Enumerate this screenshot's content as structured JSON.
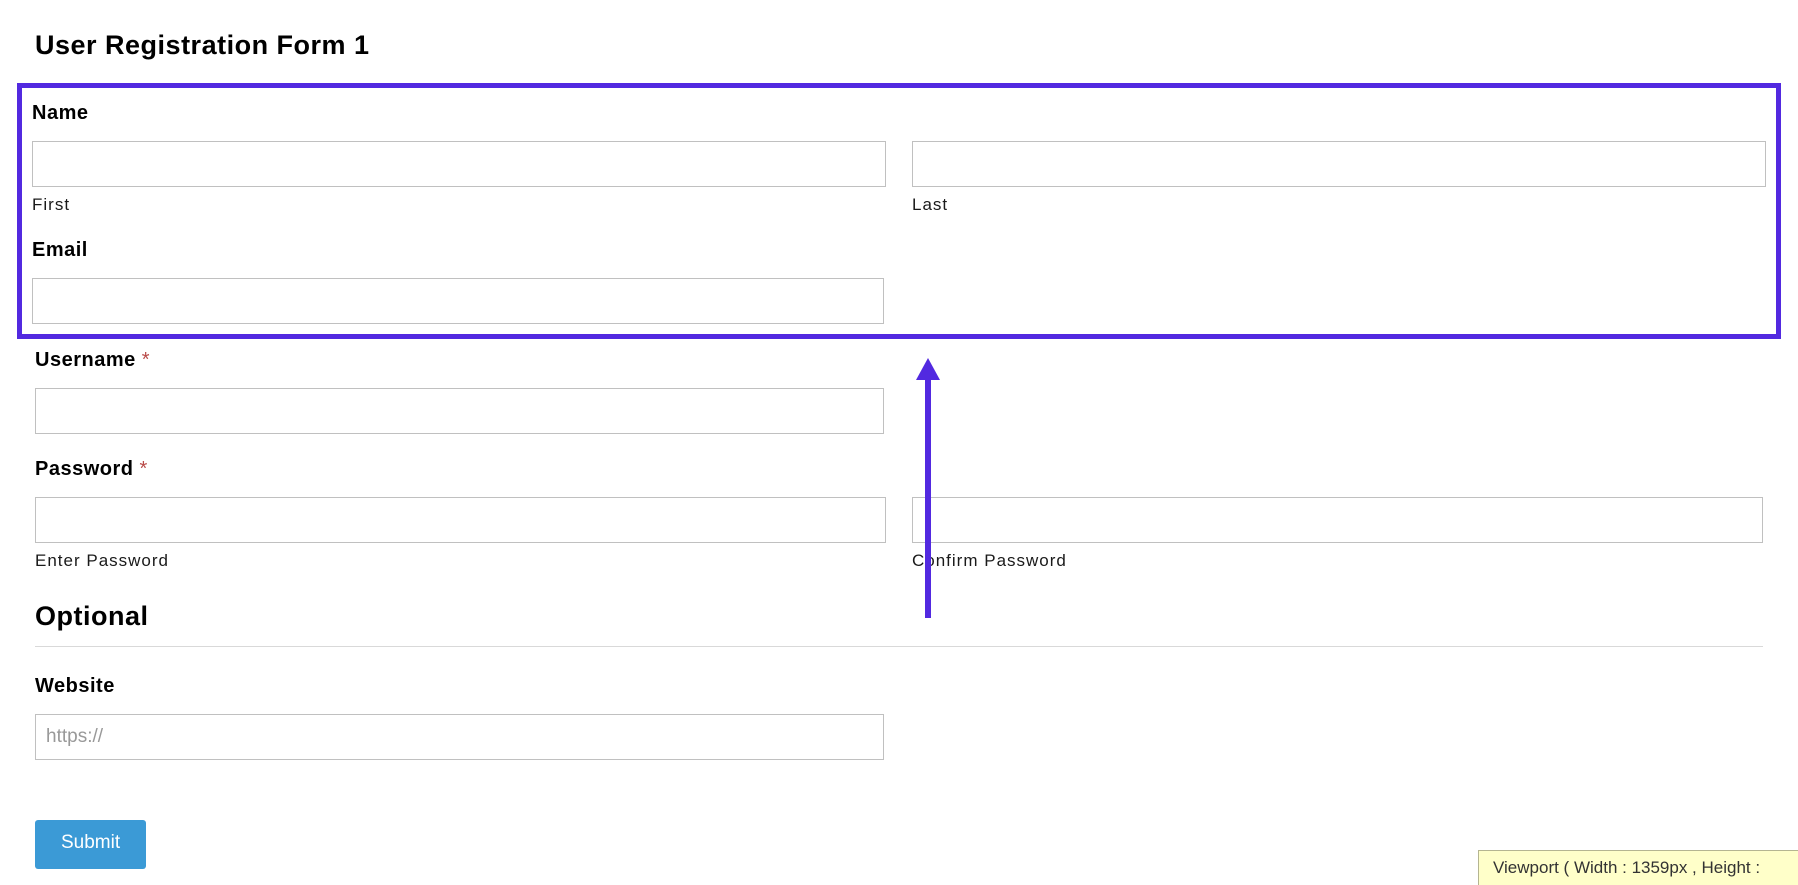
{
  "title": "User Registration Form 1",
  "highlight_border_color": "#5229e0",
  "sections": {
    "name": {
      "label": "Name",
      "first_sublabel": "First",
      "last_sublabel": "Last",
      "first_value": "",
      "last_value": ""
    },
    "email": {
      "label": "Email",
      "value": ""
    },
    "username": {
      "label": "Username",
      "required": "*",
      "value": ""
    },
    "password": {
      "label": "Password",
      "required": "*",
      "enter_sublabel": "Enter Password",
      "confirm_sublabel": "Confirm Password",
      "enter_value": "",
      "confirm_value": ""
    },
    "optional_heading": "Optional",
    "website": {
      "label": "Website",
      "placeholder": "https://",
      "value": ""
    }
  },
  "submit_label": "Submit",
  "viewport_text": "Viewport ( Width : 1359px , Height :"
}
